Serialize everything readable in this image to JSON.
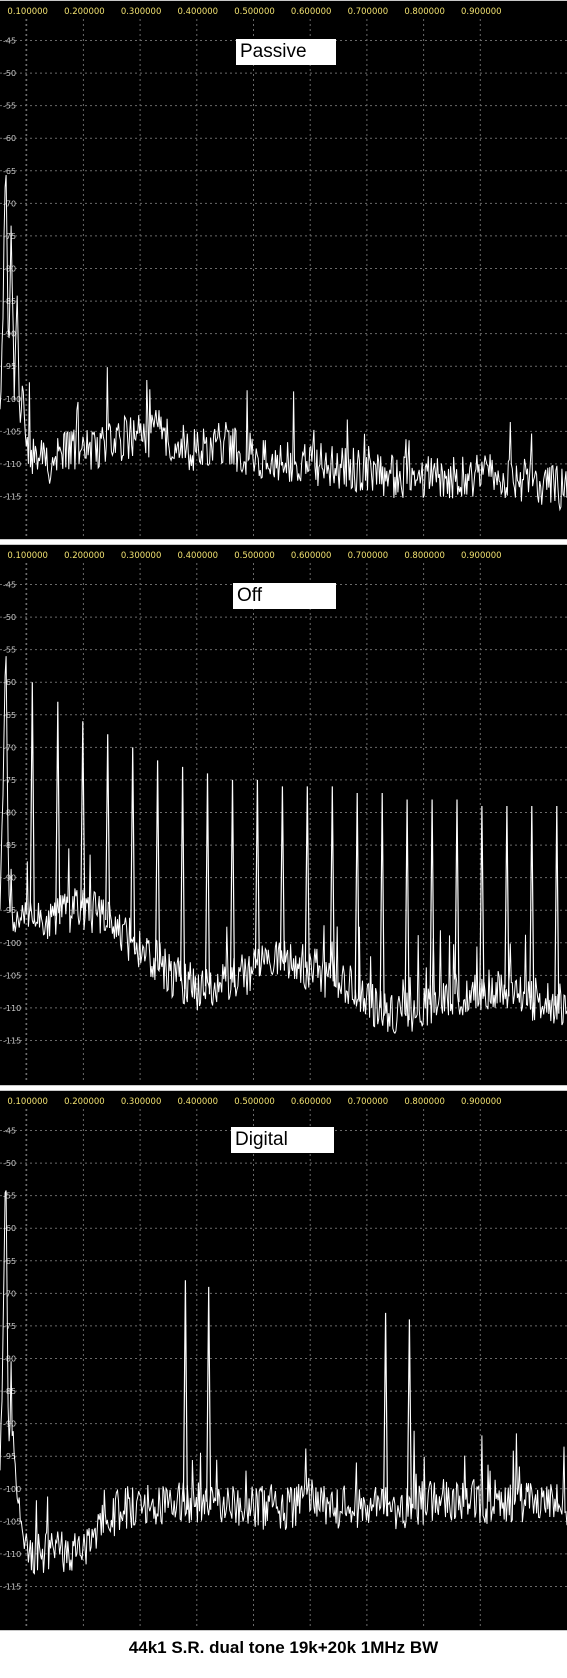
{
  "caption": "44k1 S.R.  dual tone 19k+20k  1MHz BW",
  "colors": {
    "background": "#000000",
    "grid": "#6a6a6a",
    "trace": "#ffffff",
    "x_tick_text": "#f0e070",
    "y_tick_text": "#c8c8c8"
  },
  "chart_data": [
    {
      "type": "line",
      "title": "Passive",
      "xlabel": "",
      "ylabel": "",
      "xlim": [
        0,
        1.0
      ],
      "ylim": [
        -118,
        -42
      ],
      "x_ticks": [
        "0.100000",
        "0.200000",
        "0.300000",
        "0.400000",
        "0.500000",
        "0.600000",
        "0.700000",
        "0.800000",
        "0.900000"
      ],
      "y_ticks": [
        "-45",
        "-50",
        "-55",
        "-60",
        "-65",
        "-70",
        "-75",
        "-80",
        "-85",
        "-90",
        "-95",
        "-100",
        "-105",
        "-110",
        "-115"
      ],
      "grid": true,
      "series": [
        {
          "points": [
            [
              0.0,
              -103
            ],
            [
              0.005,
              -88
            ],
            [
              0.01,
              -62
            ],
            [
              0.015,
              -96
            ],
            [
              0.02,
              -73
            ],
            [
              0.025,
              -100
            ],
            [
              0.03,
              -82
            ],
            [
              0.035,
              -104
            ],
            [
              0.04,
              -99
            ],
            [
              0.045,
              -106
            ],
            [
              0.05,
              -108
            ],
            [
              0.06,
              -109
            ],
            [
              0.08,
              -110
            ],
            [
              0.1,
              -109
            ],
            [
              0.12,
              -108
            ],
            [
              0.15,
              -108
            ],
            [
              0.18,
              -107
            ],
            [
              0.2,
              -107
            ],
            [
              0.22,
              -106
            ],
            [
              0.25,
              -106
            ],
            [
              0.28,
              -105
            ],
            [
              0.3,
              -106
            ],
            [
              0.32,
              -107
            ],
            [
              0.35,
              -108
            ],
            [
              0.38,
              -107
            ],
            [
              0.4,
              -107
            ],
            [
              0.42,
              -108
            ],
            [
              0.45,
              -109
            ],
            [
              0.48,
              -110
            ],
            [
              0.5,
              -110
            ],
            [
              0.55,
              -110
            ],
            [
              0.6,
              -111
            ],
            [
              0.65,
              -111
            ],
            [
              0.7,
              -112
            ],
            [
              0.75,
              -112
            ],
            [
              0.8,
              -112
            ],
            [
              0.85,
              -112
            ],
            [
              0.9,
              -112
            ],
            [
              0.95,
              -113
            ],
            [
              1.0,
              -114
            ]
          ]
        }
      ]
    },
    {
      "type": "line",
      "title": "Off",
      "xlabel": "",
      "ylabel": "",
      "xlim": [
        0,
        1.0
      ],
      "ylim": [
        -118,
        -42
      ],
      "x_ticks": [
        "0.100000",
        "0.200000",
        "0.300000",
        "0.400000",
        "0.500000",
        "0.600000",
        "0.700000",
        "0.800000",
        "0.900000"
      ],
      "y_ticks": [
        "-45",
        "-50",
        "-55",
        "-60",
        "-65",
        "-70",
        "-75",
        "-80",
        "-85",
        "-90",
        "-95",
        "-100",
        "-105",
        "-110",
        "-115"
      ],
      "grid": true,
      "series": [
        {
          "points": [
            [
              0.0,
              -96
            ],
            [
              0.005,
              -78
            ],
            [
              0.01,
              -52
            ],
            [
              0.015,
              -90
            ],
            [
              0.02,
              -97
            ],
            [
              0.06,
              -95
            ],
            [
              0.07,
              -96
            ],
            [
              0.1,
              -96
            ],
            [
              0.12,
              -95
            ],
            [
              0.15,
              -95
            ],
            [
              0.18,
              -96
            ],
            [
              0.2,
              -97
            ],
            [
              0.22,
              -99
            ],
            [
              0.25,
              -101
            ],
            [
              0.28,
              -103
            ],
            [
              0.3,
              -105
            ],
            [
              0.35,
              -107
            ],
            [
              0.4,
              -106
            ],
            [
              0.45,
              -104
            ],
            [
              0.5,
              -103
            ],
            [
              0.55,
              -104
            ],
            [
              0.6,
              -106
            ],
            [
              0.65,
              -109
            ],
            [
              0.7,
              -111
            ],
            [
              0.75,
              -110
            ],
            [
              0.8,
              -108
            ],
            [
              0.85,
              -107
            ],
            [
              0.9,
              -107
            ],
            [
              0.95,
              -109
            ],
            [
              1.0,
              -110
            ]
          ]
        },
        {
          "name": "spurs",
          "peaks": [
            [
              0.057,
              -60
            ],
            [
              0.102,
              -63
            ],
            [
              0.146,
              -66
            ],
            [
              0.19,
              -68
            ],
            [
              0.234,
              -70
            ],
            [
              0.278,
              -72
            ],
            [
              0.322,
              -73
            ],
            [
              0.366,
              -74
            ],
            [
              0.41,
              -75
            ],
            [
              0.454,
              -75
            ],
            [
              0.498,
              -76
            ],
            [
              0.542,
              -76
            ],
            [
              0.586,
              -76
            ],
            [
              0.63,
              -77
            ],
            [
              0.674,
              -77
            ],
            [
              0.718,
              -78
            ],
            [
              0.762,
              -78
            ],
            [
              0.806,
              -78
            ],
            [
              0.85,
              -79
            ],
            [
              0.894,
              -79
            ],
            [
              0.938,
              -79
            ],
            [
              0.982,
              -79
            ]
          ]
        }
      ]
    },
    {
      "type": "line",
      "title": "Digital",
      "xlabel": "",
      "ylabel": "",
      "xlim": [
        0,
        1.0
      ],
      "ylim": [
        -118,
        -42
      ],
      "x_ticks": [
        "0.100000",
        "0.200000",
        "0.300000",
        "0.400000",
        "0.500000",
        "0.600000",
        "0.700000",
        "0.800000",
        "0.900000"
      ],
      "y_ticks": [
        "-45",
        "-50",
        "-55",
        "-60",
        "-65",
        "-70",
        "-75",
        "-80",
        "-85",
        "-90",
        "-95",
        "-100",
        "-105",
        "-110",
        "-115"
      ],
      "grid": true,
      "series": [
        {
          "points": [
            [
              0.0,
              -98
            ],
            [
              0.005,
              -80
            ],
            [
              0.01,
              -46
            ],
            [
              0.015,
              -92
            ],
            [
              0.02,
              -88
            ],
            [
              0.025,
              -96
            ],
            [
              0.03,
              -100
            ],
            [
              0.035,
              -104
            ],
            [
              0.04,
              -107
            ],
            [
              0.05,
              -109
            ],
            [
              0.07,
              -110
            ],
            [
              0.1,
              -110
            ],
            [
              0.13,
              -109
            ],
            [
              0.16,
              -108
            ],
            [
              0.18,
              -106
            ],
            [
              0.2,
              -104
            ],
            [
              0.22,
              -103
            ],
            [
              0.25,
              -102
            ],
            [
              0.3,
              -102
            ],
            [
              0.35,
              -102
            ],
            [
              0.4,
              -102
            ],
            [
              0.45,
              -103
            ],
            [
              0.5,
              -103
            ],
            [
              0.55,
              -102
            ],
            [
              0.6,
              -103
            ],
            [
              0.65,
              -103
            ],
            [
              0.7,
              -103
            ],
            [
              0.75,
              -102
            ],
            [
              0.8,
              -102
            ],
            [
              0.85,
              -102
            ],
            [
              0.9,
              -102
            ],
            [
              0.95,
              -102
            ],
            [
              1.0,
              -103
            ]
          ]
        },
        {
          "name": "spurs",
          "peaks": [
            [
              0.327,
              -68
            ],
            [
              0.368,
              -69
            ],
            [
              0.68,
              -73
            ],
            [
              0.722,
              -74
            ]
          ]
        }
      ]
    }
  ]
}
